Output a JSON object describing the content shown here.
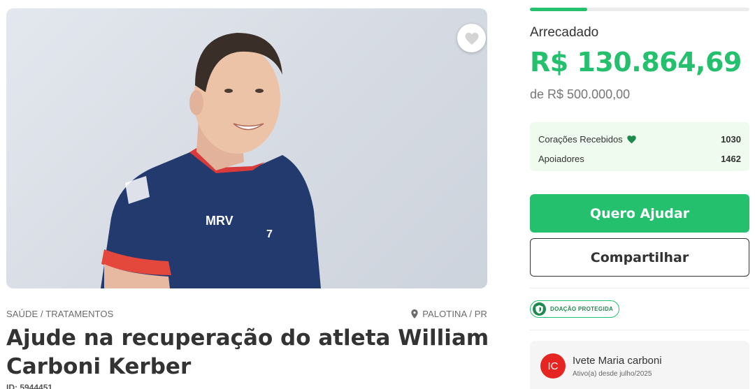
{
  "campaign": {
    "category": "SAÚDE / TRATAMENTOS",
    "location": "PALOTINA / PR",
    "title": "Ajude na recuperação do atleta William Carboni Kerber",
    "id_label": "ID: 5944451"
  },
  "image": {
    "alt": "Atleta de voleibol com camisa azul e vermelha"
  },
  "donation": {
    "progress_percent": 26.2,
    "raised_label": "Arrecadado",
    "raised_amount": "R$ 130.864,69",
    "goal_text": "de R$ 500.000,00",
    "hearts_label": "Corações Recebidos",
    "hearts_value": "1030",
    "supporters_label": "Apoiadores",
    "supporters_value": "1462"
  },
  "actions": {
    "help_label": "Quero Ajudar",
    "share_label": "Compartilhar"
  },
  "protection": {
    "badge_label": "DOAÇÃO PROTEGIDA"
  },
  "organizer": {
    "initials": "IC",
    "name": "Ivete Maria carboni",
    "since": "Ativo(a) desde julho/2025"
  },
  "colors": {
    "brand_green": "#25c06d",
    "avatar_red": "#e52521"
  }
}
